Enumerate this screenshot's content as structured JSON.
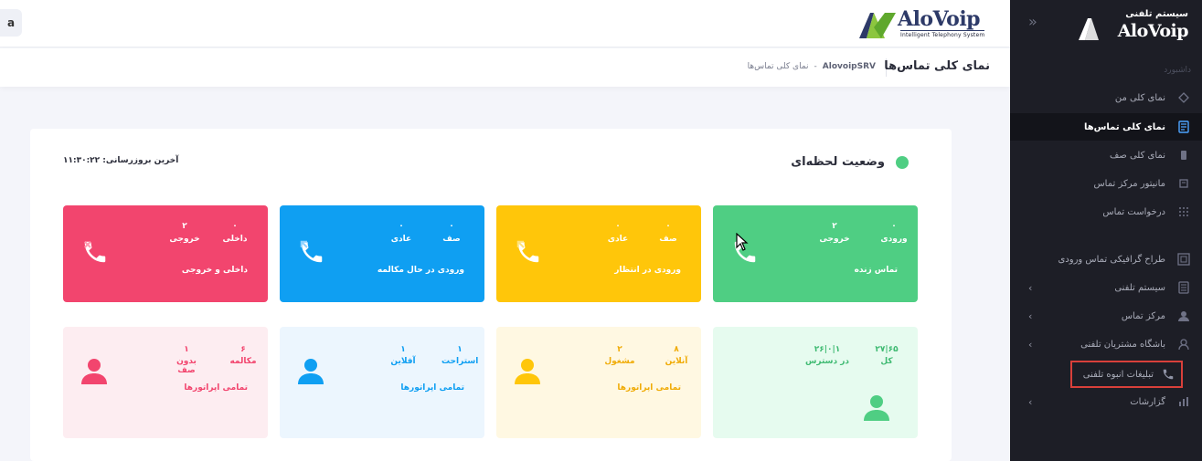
{
  "sidebar": {
    "brand_fa": "سیستم تلفنی",
    "brand_en": "AloVoip",
    "collapse_icon": "double-chevron",
    "section_label": "داشبورد",
    "items": [
      {
        "label": "نمای کلی من",
        "icon": "dashboard-icon"
      },
      {
        "label": "نمای کلی تماس‌ها",
        "icon": "calls-overview-icon",
        "active": true
      },
      {
        "label": "نمای کلی صف",
        "icon": "queue-icon"
      },
      {
        "label": "مانیتور مرکز تماس",
        "icon": "monitor-icon"
      },
      {
        "label": "درخواست تماس",
        "icon": "grid-icon"
      },
      {
        "label": "طراح گرافیکی تماس ورودی",
        "icon": "designer-icon"
      },
      {
        "label": "سیستم تلفنی",
        "icon": "phone-system-icon",
        "expandable": true
      },
      {
        "label": "مرکز تماس",
        "icon": "agent-icon",
        "expandable": true
      },
      {
        "label": "باشگاه مشتریان تلفنی",
        "icon": "club-icon",
        "expandable": true
      },
      {
        "label": "تبلیغات انبوه تلفنی",
        "icon": "phone-icon",
        "highlighted": true
      },
      {
        "label": "گزارشات",
        "icon": "chart-icon",
        "expandable": true
      }
    ]
  },
  "topbar": {
    "brand_en": "AloVoip",
    "brand_sub": "Intelligent Telephony System",
    "user_initial": "a"
  },
  "subheader": {
    "title": "نمای کلی تماس‌ها",
    "breadcrumb": [
      "AlovoipSRV",
      "-",
      "نمای کلی تماس‌ها"
    ]
  },
  "live": {
    "title": "وضعیت لحظه‌ای",
    "last_update": "آخرین بروزرسانی: ۱۱:۳۰:۲۲"
  },
  "call_tiles": [
    {
      "caption": "تماس زنده",
      "color": "#4fce83",
      "cols": [
        {
          "label": "ورودی",
          "value": "۰"
        },
        {
          "label": "خروجی",
          "value": "۲"
        }
      ]
    },
    {
      "caption": "ورودی در انتظار",
      "color": "#ffc60a",
      "cols": [
        {
          "label": "صف",
          "value": "۰"
        },
        {
          "label": "عادی",
          "value": "۰"
        }
      ]
    },
    {
      "caption": "ورودی در حال مکالمه",
      "color": "#0f9ff2",
      "cols": [
        {
          "label": "صف",
          "value": "۰"
        },
        {
          "label": "عادی",
          "value": "۰"
        }
      ]
    },
    {
      "caption": "داخلی و خروجی",
      "color": "#f2456e",
      "cols": [
        {
          "label": "داخلی",
          "value": "۰"
        },
        {
          "label": "خروجی",
          "value": "۲"
        }
      ]
    }
  ],
  "operator_tiles": [
    {
      "caption": "",
      "color": "#4fce83",
      "bg": "#e6fbef",
      "cols": [
        {
          "label": "کل",
          "value": "۲۷|۶۵"
        },
        {
          "label": "در دسترس",
          "value": "۲۶|۰|۱"
        }
      ]
    },
    {
      "caption": "تمامی اپراتورها",
      "color": "#f0ac08",
      "bg": "#fff8e2",
      "cols": [
        {
          "label": "آنلاین",
          "value": "۸"
        },
        {
          "label": "مشغول",
          "value": "۲"
        }
      ]
    },
    {
      "caption": "تمامی اپراتورها",
      "color": "#0f9ff2",
      "bg": "#ecf6fe",
      "cols": [
        {
          "label": "استراحت",
          "value": "۱"
        },
        {
          "label": "آفلاین",
          "value": "۱"
        }
      ]
    },
    {
      "caption": "تمامی اپراتورها",
      "color": "#f2456e",
      "bg": "#fdedf1",
      "cols": [
        {
          "label": "مکالمه",
          "value": "۶"
        },
        {
          "label": "بدون صف",
          "value": "۱"
        }
      ]
    }
  ]
}
